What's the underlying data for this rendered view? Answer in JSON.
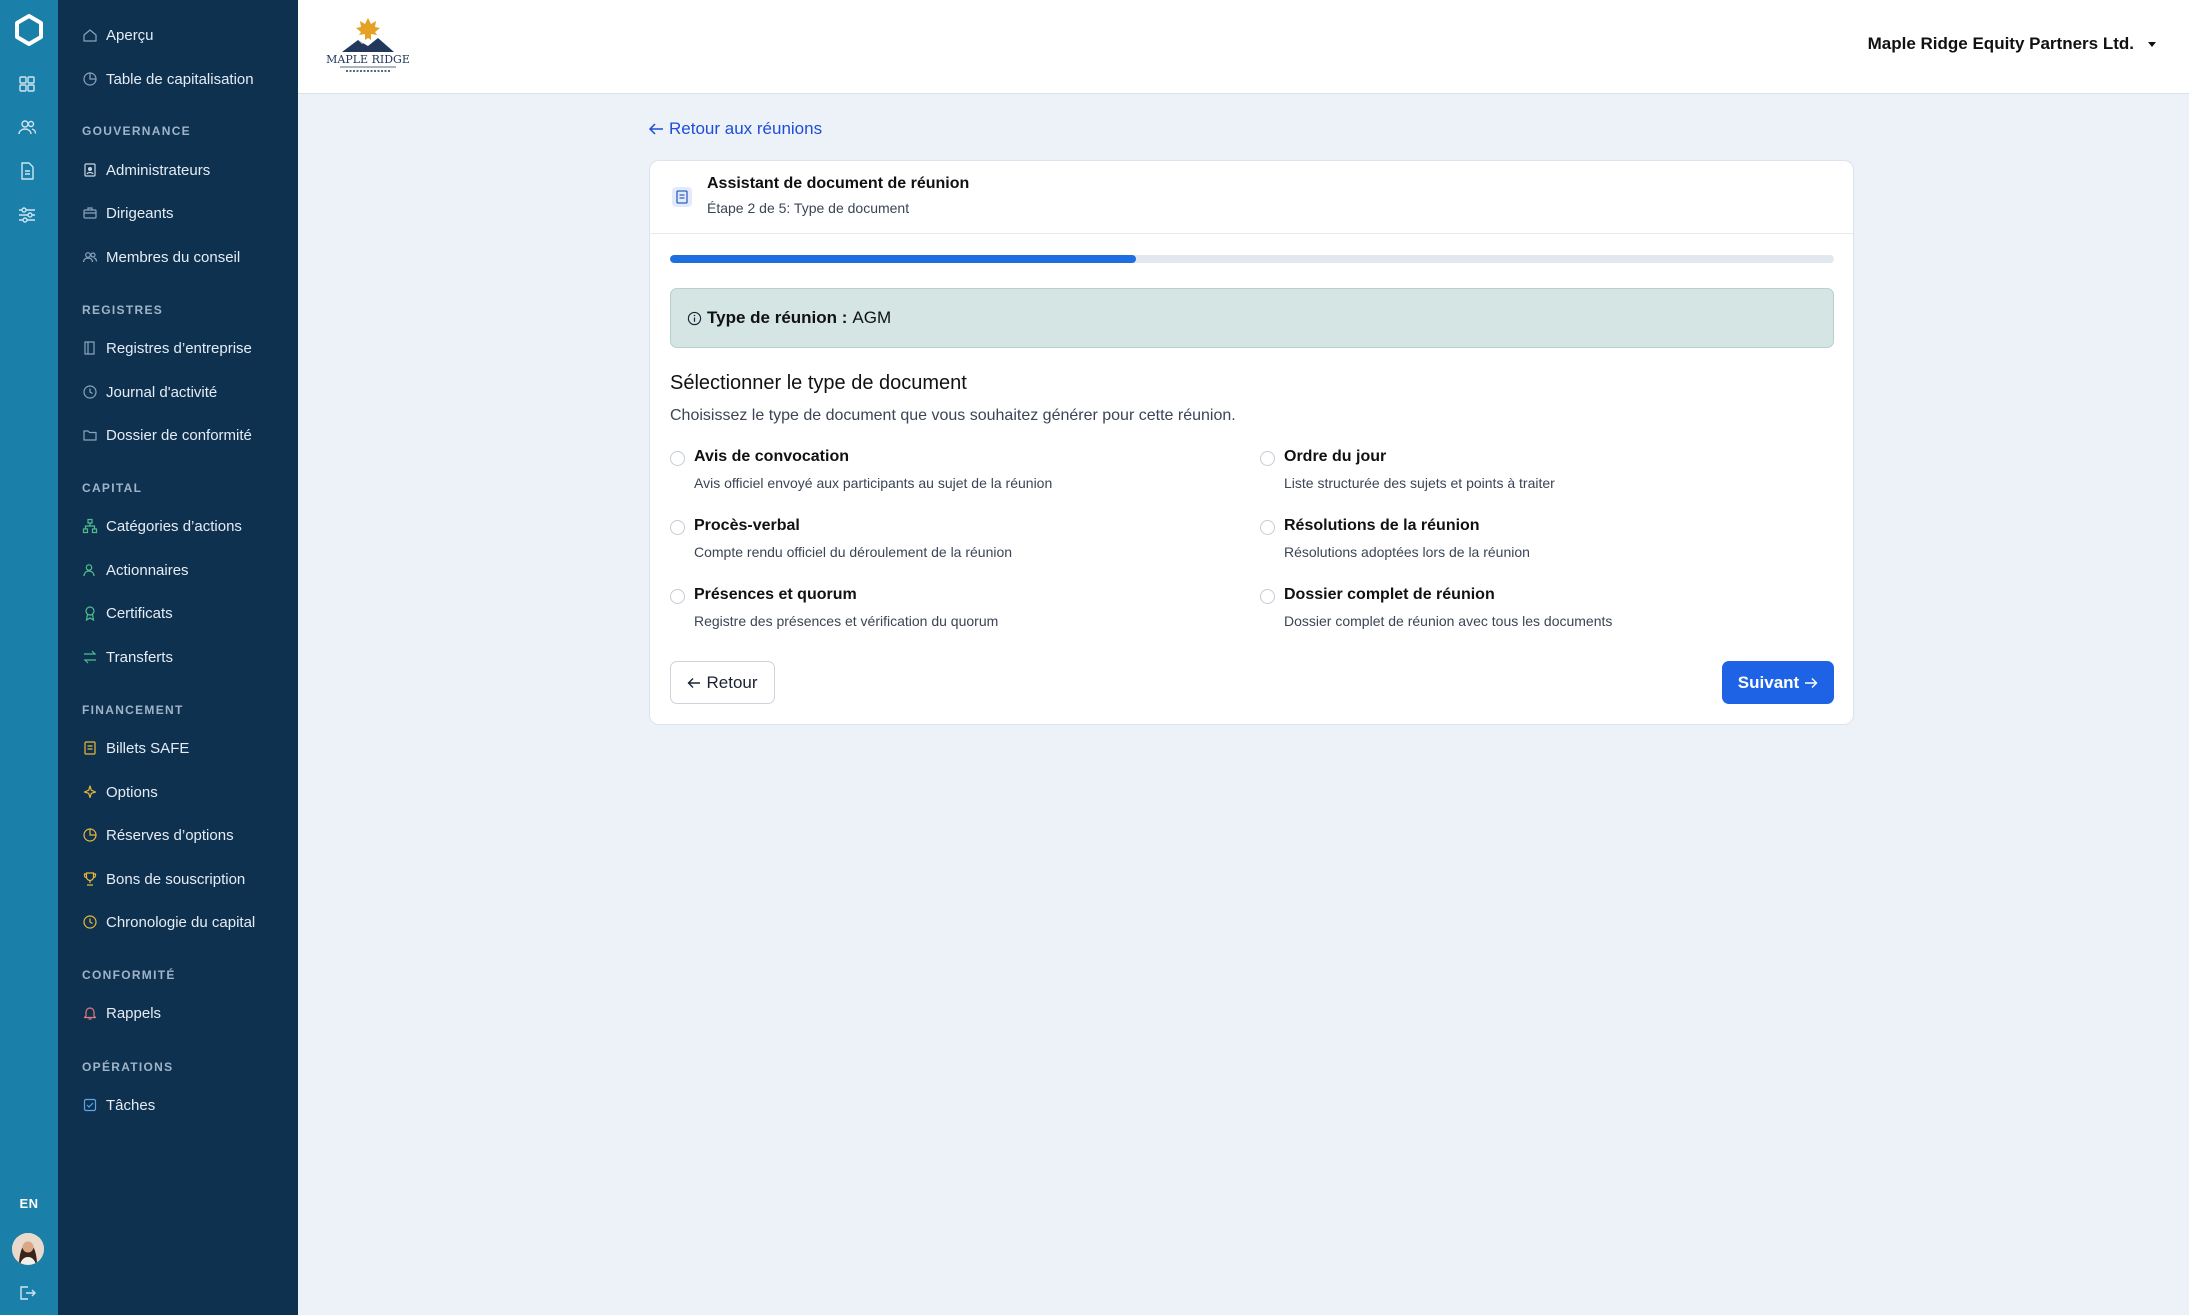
{
  "rail": {
    "lang": "EN",
    "icons": [
      "grid-icon",
      "users-icon",
      "document-icon",
      "sliders-icon"
    ]
  },
  "sidebar": {
    "items_top": [
      {
        "label": "Aperçu",
        "icon": "home-icon"
      },
      {
        "label": "Table de capitalisation",
        "icon": "pie-chart-icon"
      }
    ],
    "sections": [
      {
        "title": "GOUVERNANCE",
        "items": [
          {
            "label": "Administrateurs",
            "icon": "id-badge-icon"
          },
          {
            "label": "Dirigeants",
            "icon": "briefcase-icon"
          },
          {
            "label": "Membres du conseil",
            "icon": "users-icon"
          }
        ]
      },
      {
        "title": "REGISTRES",
        "items": [
          {
            "label": "Registres d’entreprise",
            "icon": "book-icon"
          },
          {
            "label": "Journal d'activité",
            "icon": "clock-icon"
          },
          {
            "label": "Dossier de conformité",
            "icon": "folder-icon"
          }
        ]
      },
      {
        "title": "CAPITAL",
        "items": [
          {
            "label": "Catégories d’actions",
            "icon": "hierarchy-icon"
          },
          {
            "label": "Actionnaires",
            "icon": "user-icon"
          },
          {
            "label": "Certificats",
            "icon": "award-icon"
          },
          {
            "label": "Transferts",
            "icon": "transfer-icon"
          }
        ]
      },
      {
        "title": "FINANCEMENT",
        "items": [
          {
            "label": "Billets SAFE",
            "icon": "note-icon"
          },
          {
            "label": "Options",
            "icon": "sparkle-icon"
          },
          {
            "label": "Réserves d’options",
            "icon": "pie-chart-icon"
          },
          {
            "label": "Bons de souscription",
            "icon": "trophy-icon"
          },
          {
            "label": "Chronologie du capital",
            "icon": "clock-icon"
          }
        ]
      },
      {
        "title": "CONFORMITÉ",
        "items": [
          {
            "label": "Rappels",
            "icon": "bell-icon"
          }
        ]
      },
      {
        "title": "OPÉRATIONS",
        "items": [
          {
            "label": "Tâches",
            "icon": "checkbox-icon"
          }
        ]
      }
    ]
  },
  "header": {
    "logo_text": "MAPLE RIDGE",
    "company": "Maple Ridge Equity Partners Ltd."
  },
  "main": {
    "back_link": "Retour aux réunions",
    "card": {
      "title": "Assistant de document de réunion",
      "subtitle": "Étape 2 de 5: Type de document",
      "progress": 0.4,
      "info_label": "Type de réunion :",
      "info_value": "AGM",
      "section_title": "Sélectionner le type de document",
      "section_desc": "Choisissez le type de document que vous souhaitez générer pour cette réunion.",
      "options": [
        {
          "title": "Avis de convocation",
          "desc": "Avis officiel envoyé aux participants au sujet de la réunion"
        },
        {
          "title": "Ordre du jour",
          "desc": "Liste structurée des sujets et points à traiter"
        },
        {
          "title": "Procès-verbal",
          "desc": "Compte rendu officiel du déroulement de la réunion"
        },
        {
          "title": "Résolutions de la réunion",
          "desc": "Résolutions adoptées lors de la réunion"
        },
        {
          "title": "Présences et quorum",
          "desc": "Registre des présences et vérification du quorum"
        },
        {
          "title": "Dossier complet de réunion",
          "desc": "Dossier complet de réunion avec tous les documents"
        }
      ],
      "back_button": "Retour",
      "next_button": "Suivant"
    }
  },
  "colors": {
    "rail": "#1a7fa9",
    "sidebar": "#0f3150",
    "accent": "#1e63e6",
    "info_bg": "#d4e5e3"
  }
}
